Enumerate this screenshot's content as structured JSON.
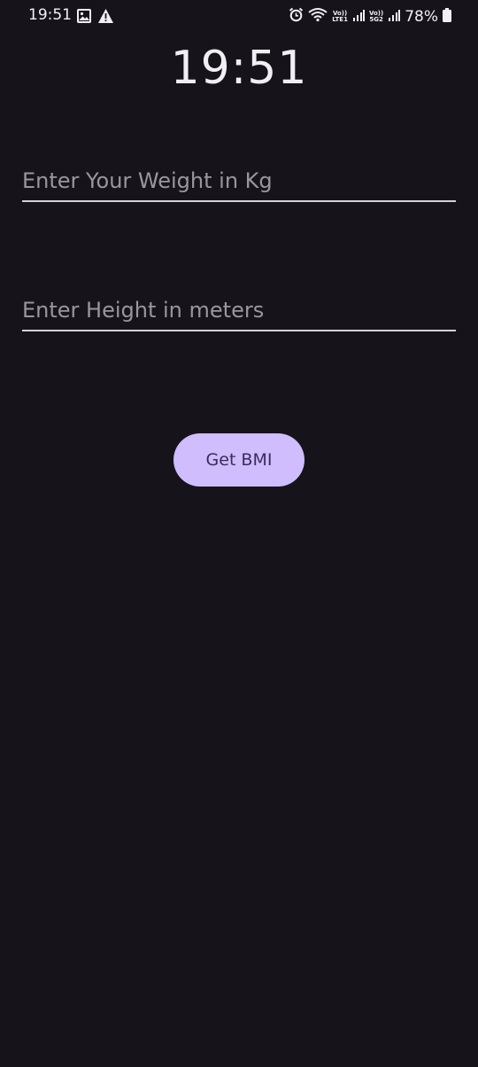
{
  "status_bar": {
    "time": "19:51",
    "left_icons": [
      "image-icon",
      "warning-icon"
    ],
    "right_icons": [
      "alarm-icon",
      "wifi-icon",
      "signal-icon",
      "signal-icon",
      "battery-icon"
    ],
    "sim1_label_top": "Vo))",
    "sim1_label_bottom": "LTE1",
    "sim2_label_top": "Vo))",
    "sim2_label_bottom": "5G2",
    "battery_percent": "78%"
  },
  "clock": {
    "time": "19:51"
  },
  "form": {
    "weight_placeholder": "Enter Your Weight in Kg",
    "weight_value": "",
    "height_placeholder": "Enter Height in meters",
    "height_value": ""
  },
  "actions": {
    "get_bmi_label": "Get BMI"
  },
  "colors": {
    "background": "#16141a",
    "button_background": "#cfbdfd",
    "button_text": "#3a2c5a",
    "underline": "#d6d2d8",
    "placeholder": "#9a969c"
  }
}
